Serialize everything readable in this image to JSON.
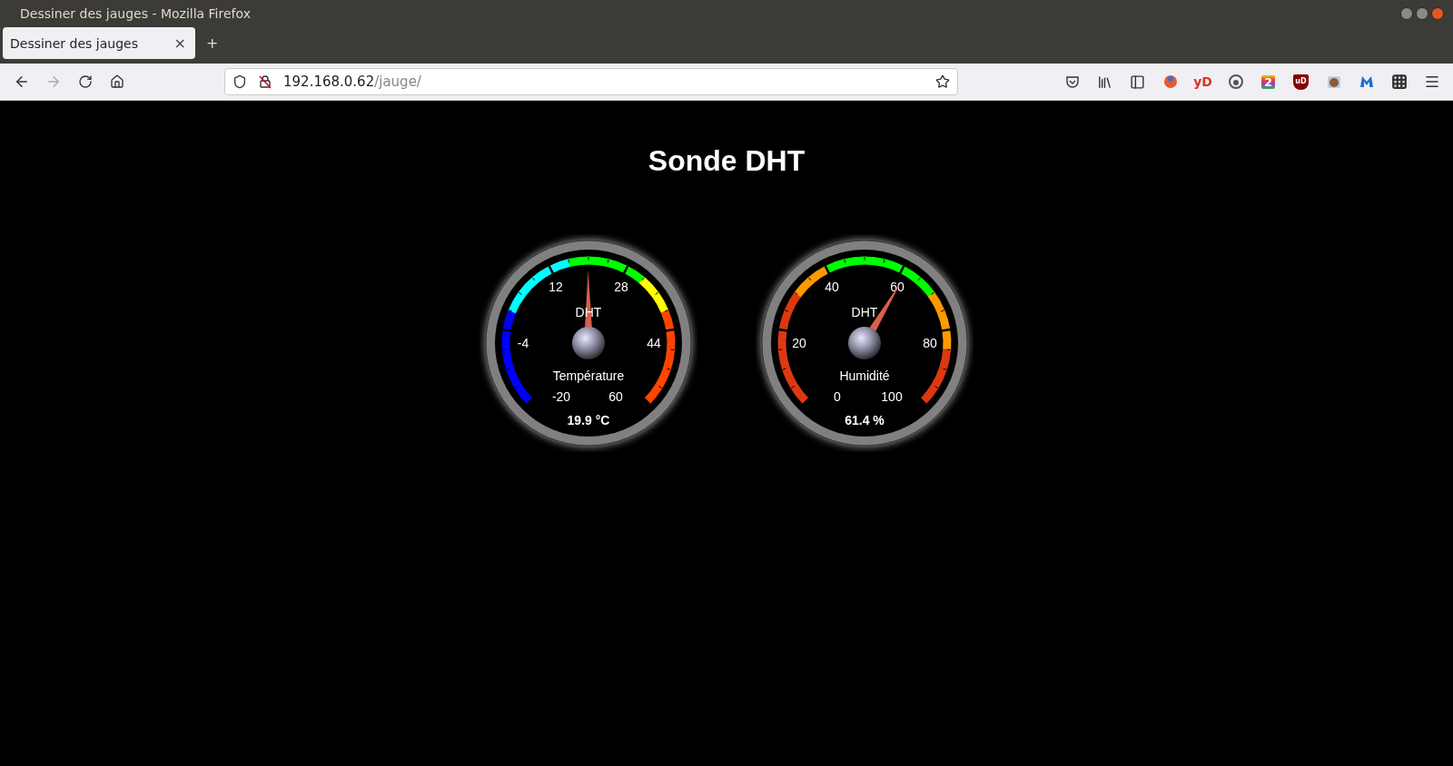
{
  "window": {
    "title": "Dessiner des jauges - Mozilla Firefox"
  },
  "tabs": [
    {
      "label": "Dessiner des jauges",
      "selected": true,
      "close": "×"
    }
  ],
  "new_tab": "+",
  "address_bar": {
    "host": "192.168.0.62",
    "path": "/jauge/"
  },
  "extensions": [
    {
      "kind": "mascot"
    },
    {
      "kind": "text",
      "label": "yD"
    },
    {
      "kind": "ring"
    },
    {
      "kind": "badge",
      "label": "2"
    },
    {
      "kind": "shield",
      "label": "uD"
    },
    {
      "kind": "cookie"
    },
    {
      "kind": "malware"
    }
  ],
  "page": {
    "title": "Sonde DHT"
  },
  "gauges": [
    {
      "header": "DHT",
      "title": "Température",
      "value": "19.9 °C",
      "level": 0.499,
      "scale": [
        "-20",
        "-4",
        "12",
        "28",
        "44",
        "60"
      ],
      "segments": [
        {
          "color": "#0000ff"
        },
        {
          "color": "#0000ff"
        },
        {
          "color": "#0000ff"
        },
        {
          "color": "#0000ff"
        },
        {
          "color": "#0000ff"
        },
        {
          "color": "#00ffff"
        },
        {
          "color": "#00ffff"
        },
        {
          "color": "#00ffff"
        },
        {
          "color": "#00ffff"
        },
        {
          "color": "#00ff00"
        },
        {
          "color": "#00ff00"
        },
        {
          "color": "#00ff00"
        },
        {
          "color": "#00ff00"
        },
        {
          "color": "#ffff00"
        },
        {
          "color": "#ffff00"
        },
        {
          "color": "#ff4500"
        },
        {
          "color": "#ff4500"
        },
        {
          "color": "#ff4500"
        },
        {
          "color": "#ff4500"
        },
        {
          "color": "#ff4500"
        }
      ]
    },
    {
      "header": "DHT",
      "title": "Humidité",
      "value": "61.4 %",
      "level": 0.614,
      "scale": [
        "0",
        "20",
        "40",
        "60",
        "80",
        "100"
      ],
      "segments": [
        {
          "color": "#dc3912"
        },
        {
          "color": "#dc3912"
        },
        {
          "color": "#dc3912"
        },
        {
          "color": "#dc3912"
        },
        {
          "color": "#dc3912"
        },
        {
          "color": "#dc3912"
        },
        {
          "color": "#ff9900"
        },
        {
          "color": "#ff9900"
        },
        {
          "color": "#00ff00"
        },
        {
          "color": "#00ff00"
        },
        {
          "color": "#00ff00"
        },
        {
          "color": "#00ff00"
        },
        {
          "color": "#00ff00"
        },
        {
          "color": "#00ff00"
        },
        {
          "color": "#ff9900"
        },
        {
          "color": "#ff9900"
        },
        {
          "color": "#ff9900"
        },
        {
          "color": "#dc3912"
        },
        {
          "color": "#dc3912"
        },
        {
          "color": "#dc3912"
        }
      ]
    }
  ]
}
